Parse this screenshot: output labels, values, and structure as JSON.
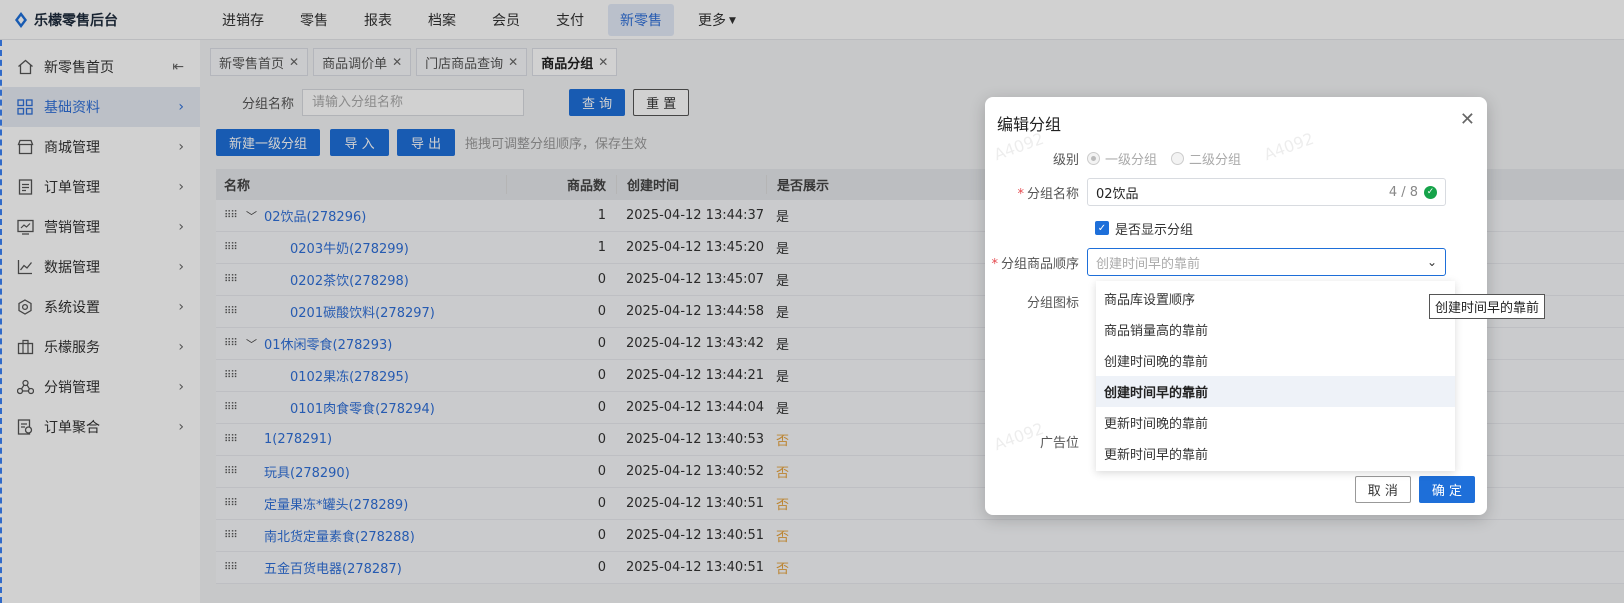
{
  "app": {
    "title": "乐檬零售后台"
  },
  "topnav": [
    {
      "label": "进销存",
      "active": false
    },
    {
      "label": "零售",
      "active": false
    },
    {
      "label": "报表",
      "active": false
    },
    {
      "label": "档案",
      "active": false
    },
    {
      "label": "会员",
      "active": false
    },
    {
      "label": "支付",
      "active": false
    },
    {
      "label": "新零售",
      "active": true
    },
    {
      "label": "更多",
      "active": false
    }
  ],
  "sidebar": {
    "items": [
      {
        "label": "新零售首页",
        "icon": "home-icon"
      },
      {
        "label": "基础资料",
        "icon": "grid-icon"
      },
      {
        "label": "商城管理",
        "icon": "store-icon"
      },
      {
        "label": "订单管理",
        "icon": "order-icon"
      },
      {
        "label": "营销管理",
        "icon": "marketing-icon"
      },
      {
        "label": "数据管理",
        "icon": "chart-line-icon"
      },
      {
        "label": "系统设置",
        "icon": "settings-icon"
      },
      {
        "label": "乐檬服务",
        "icon": "service-icon"
      },
      {
        "label": "分销管理",
        "icon": "distribution-icon"
      },
      {
        "label": "订单聚合",
        "icon": "order-aggregate-icon"
      }
    ]
  },
  "tabs": [
    {
      "label": "新零售首页"
    },
    {
      "label": "商品调价单"
    },
    {
      "label": "门店商品查询"
    },
    {
      "label": "商品分组"
    }
  ],
  "filter": {
    "label": "分组名称",
    "placeholder": "请输入分组名称",
    "query_btn": "查 询",
    "reset_btn": "重 置"
  },
  "actions": {
    "new_btn": "新建一级分组",
    "import_btn": "导 入",
    "export_btn": "导 出",
    "hint": "拖拽可调整分组顺序，保存生效"
  },
  "table": {
    "headers": {
      "name": "名称",
      "count": "商品数",
      "time": "创建时间",
      "show": "是否展示"
    },
    "rows": [
      {
        "name": "02饮品(278296)",
        "count": "1",
        "time": "2025-04-12 13:44:37",
        "show": "是",
        "level": 1,
        "expand": true
      },
      {
        "name": "0203牛奶(278299)",
        "count": "1",
        "time": "2025-04-12 13:45:20",
        "show": "是",
        "level": 2
      },
      {
        "name": "0202茶饮(278298)",
        "count": "0",
        "time": "2025-04-12 13:45:07",
        "show": "是",
        "level": 2
      },
      {
        "name": "0201碳酸饮料(278297)",
        "count": "0",
        "time": "2025-04-12 13:44:58",
        "show": "是",
        "level": 2
      },
      {
        "name": "01休闲零食(278293)",
        "count": "0",
        "time": "2025-04-12 13:43:42",
        "show": "是",
        "level": 1,
        "expand": true
      },
      {
        "name": "0102果冻(278295)",
        "count": "0",
        "time": "2025-04-12 13:44:21",
        "show": "是",
        "level": 2
      },
      {
        "name": "0101肉食零食(278294)",
        "count": "0",
        "time": "2025-04-12 13:44:04",
        "show": "是",
        "level": 2
      },
      {
        "name": "1(278291)",
        "count": "0",
        "time": "2025-04-12 13:40:53",
        "show": "否",
        "level": 1
      },
      {
        "name": "玩具(278290)",
        "count": "0",
        "time": "2025-04-12 13:40:52",
        "show": "否",
        "level": 1
      },
      {
        "name": "定量果冻*罐头(278289)",
        "count": "0",
        "time": "2025-04-12 13:40:51",
        "show": "否",
        "level": 1
      },
      {
        "name": "南北货定量素食(278288)",
        "count": "0",
        "time": "2025-04-12 13:40:51",
        "show": "否",
        "level": 1
      },
      {
        "name": "五金百货电器(278287)",
        "count": "0",
        "time": "2025-04-12 13:40:51",
        "show": "否",
        "level": 1
      }
    ]
  },
  "dialog": {
    "title": "编辑分组",
    "level_label": "级别",
    "level_opt1": "一级分组",
    "level_opt2": "二级分组",
    "name_label": "分组名称",
    "name_value": "02饮品",
    "name_count": "4 / 8",
    "show_label": "是否显示分组",
    "order_label": "分组商品顺序",
    "order_placeholder": "创建时间早的靠前",
    "icon_label": "分组图标",
    "ad_label": "广告位",
    "cancel_btn": "取 消",
    "ok_btn": "确 定",
    "watermark": "A4092"
  },
  "dropdown": {
    "options": [
      {
        "label": "商品库设置顺序",
        "selected": false
      },
      {
        "label": "商品销量高的靠前",
        "selected": false
      },
      {
        "label": "创建时间晚的靠前",
        "selected": false
      },
      {
        "label": "创建时间早的靠前",
        "selected": true
      },
      {
        "label": "更新时间晚的靠前",
        "selected": false
      },
      {
        "label": "更新时间早的靠前",
        "selected": false
      }
    ]
  },
  "tooltip": {
    "text": "创建时间早的靠前"
  },
  "colors": {
    "primary": "#1e6fd9",
    "link": "#2f6fd8",
    "warning": "#e6a23c",
    "success": "#16a34a"
  }
}
